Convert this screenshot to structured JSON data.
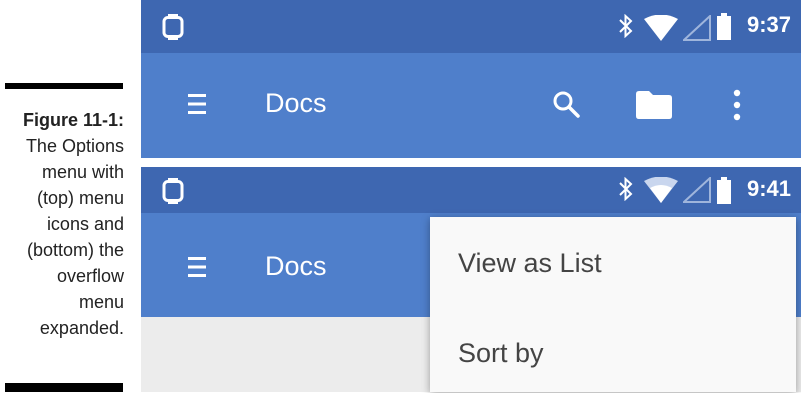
{
  "caption": {
    "figure_label": "Figure 11-1:",
    "lines": [
      "The Options",
      "menu with",
      "(top) menu",
      "icons and",
      "(bottom) the",
      "overflow",
      "menu",
      "expanded."
    ]
  },
  "top_screen": {
    "status_bar": {
      "time": "9:37",
      "icons": [
        "watch-icon",
        "bluetooth-icon",
        "wifi-icon",
        "signal-icon",
        "battery-icon"
      ]
    },
    "app_bar": {
      "title": "Docs",
      "actions": [
        "search-icon",
        "folder-icon",
        "overflow-menu-icon"
      ]
    }
  },
  "bottom_screen": {
    "status_bar": {
      "time": "9:41",
      "icons": [
        "watch-icon",
        "bluetooth-icon",
        "wifi-icon",
        "signal-icon",
        "battery-icon"
      ]
    },
    "app_bar": {
      "title": "Docs"
    },
    "overflow_menu": {
      "items": [
        "View as List",
        "Sort by"
      ]
    }
  },
  "colors": {
    "status_bar": "#3e67b1",
    "app_bar": "#4f7fcb",
    "menu_bg": "#f9f9f9",
    "content_bg": "#ececec"
  }
}
